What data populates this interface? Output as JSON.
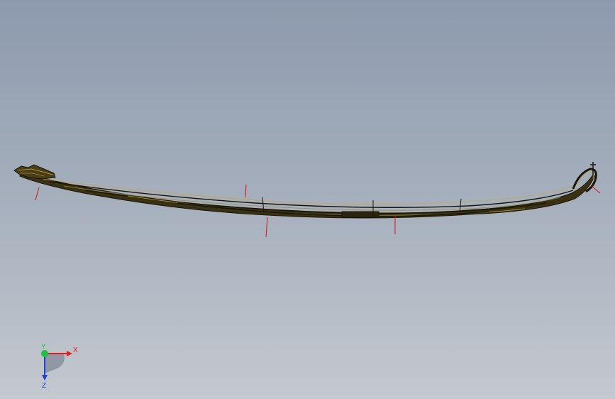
{
  "viewport": {
    "background_top": "#8d9aad",
    "background_bottom": "#c4c8cf"
  },
  "model": {
    "part_icon": "leaf-spring-3d-model",
    "edge_color": "#1a1608",
    "face_color": "#5a4a20",
    "highlight_color": "#c8a64a"
  },
  "reference_lines": {
    "color": "#e01010"
  },
  "triad": {
    "x_label": "X",
    "y_label": "Y",
    "z_label": "Z",
    "x_color": "#e02020",
    "y_color": "#20c040",
    "z_color": "#2040d0"
  }
}
